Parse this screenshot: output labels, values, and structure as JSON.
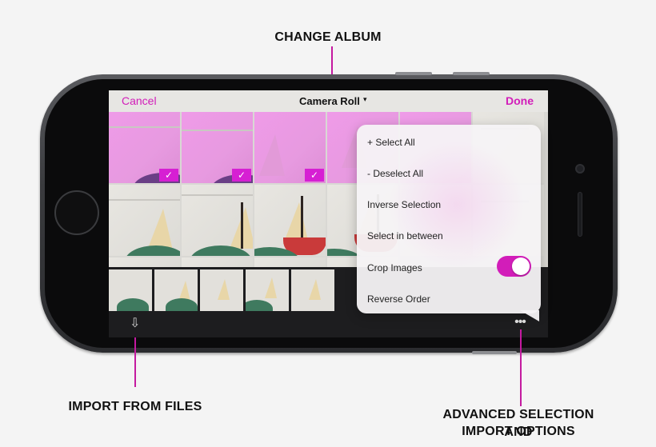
{
  "callouts": {
    "change_album": "CHANGE ALBUM",
    "import_from_files": "IMPORT FROM FILES",
    "advanced_line1": "ADVANCED SELECTION AND",
    "advanced_line2": "IMPORT OPTIONS"
  },
  "navbar": {
    "cancel_label": "Cancel",
    "album_title": "Camera Roll",
    "album_caret": "▾",
    "done_label": "Done"
  },
  "grid": {
    "selected_count": 3
  },
  "menu": {
    "items": [
      {
        "label": "+ Select All"
      },
      {
        "label": "- Deselect All"
      },
      {
        "label": "Inverse Selection"
      },
      {
        "label": "Select in between"
      },
      {
        "label": "Crop Images",
        "toggle_on": true
      },
      {
        "label": "Reverse Order"
      }
    ]
  },
  "toolbar": {
    "import_icon": "import-icon",
    "more_icon": "more-icon",
    "more_glyph": "•••",
    "import_glyph": "⇩"
  },
  "colors": {
    "accent": "#d21db9",
    "callout_line": "#c41aa0",
    "check_badge": "#d61fd3"
  }
}
